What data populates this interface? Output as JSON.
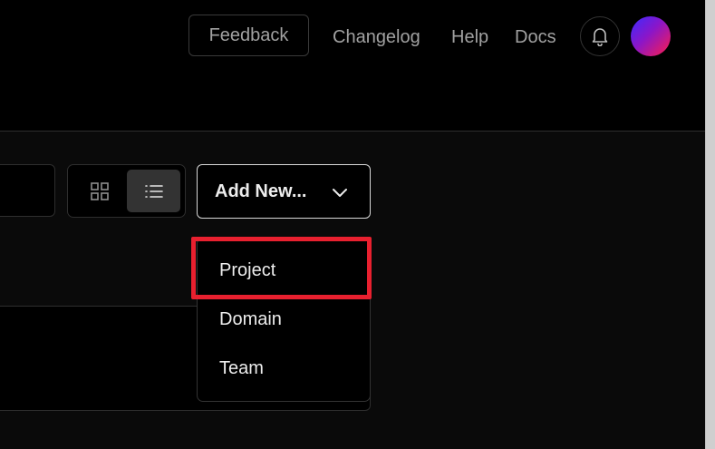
{
  "header": {
    "feedback_label": "Feedback",
    "nav": {
      "changelog": "Changelog",
      "help": "Help",
      "docs": "Docs"
    },
    "bell_icon": "bell-icon",
    "avatar_gradient": [
      "#3b2bff",
      "#8a16c9",
      "#ff1d4a"
    ]
  },
  "toolbar": {
    "view_toggle": {
      "grid_icon": "grid-icon",
      "list_icon": "list-icon",
      "selected": "list"
    },
    "add_new": {
      "label": "Add New...",
      "icon": "chevron-down-icon"
    }
  },
  "dropdown": {
    "items": [
      "Project",
      "Domain",
      "Team"
    ],
    "highlighted": "Project",
    "highlight_color": "#e8202f"
  },
  "colors": {
    "background": "#000000",
    "panel_border": "#2e2e2e",
    "text_primary": "#ededed",
    "text_muted": "#a1a1a1"
  }
}
